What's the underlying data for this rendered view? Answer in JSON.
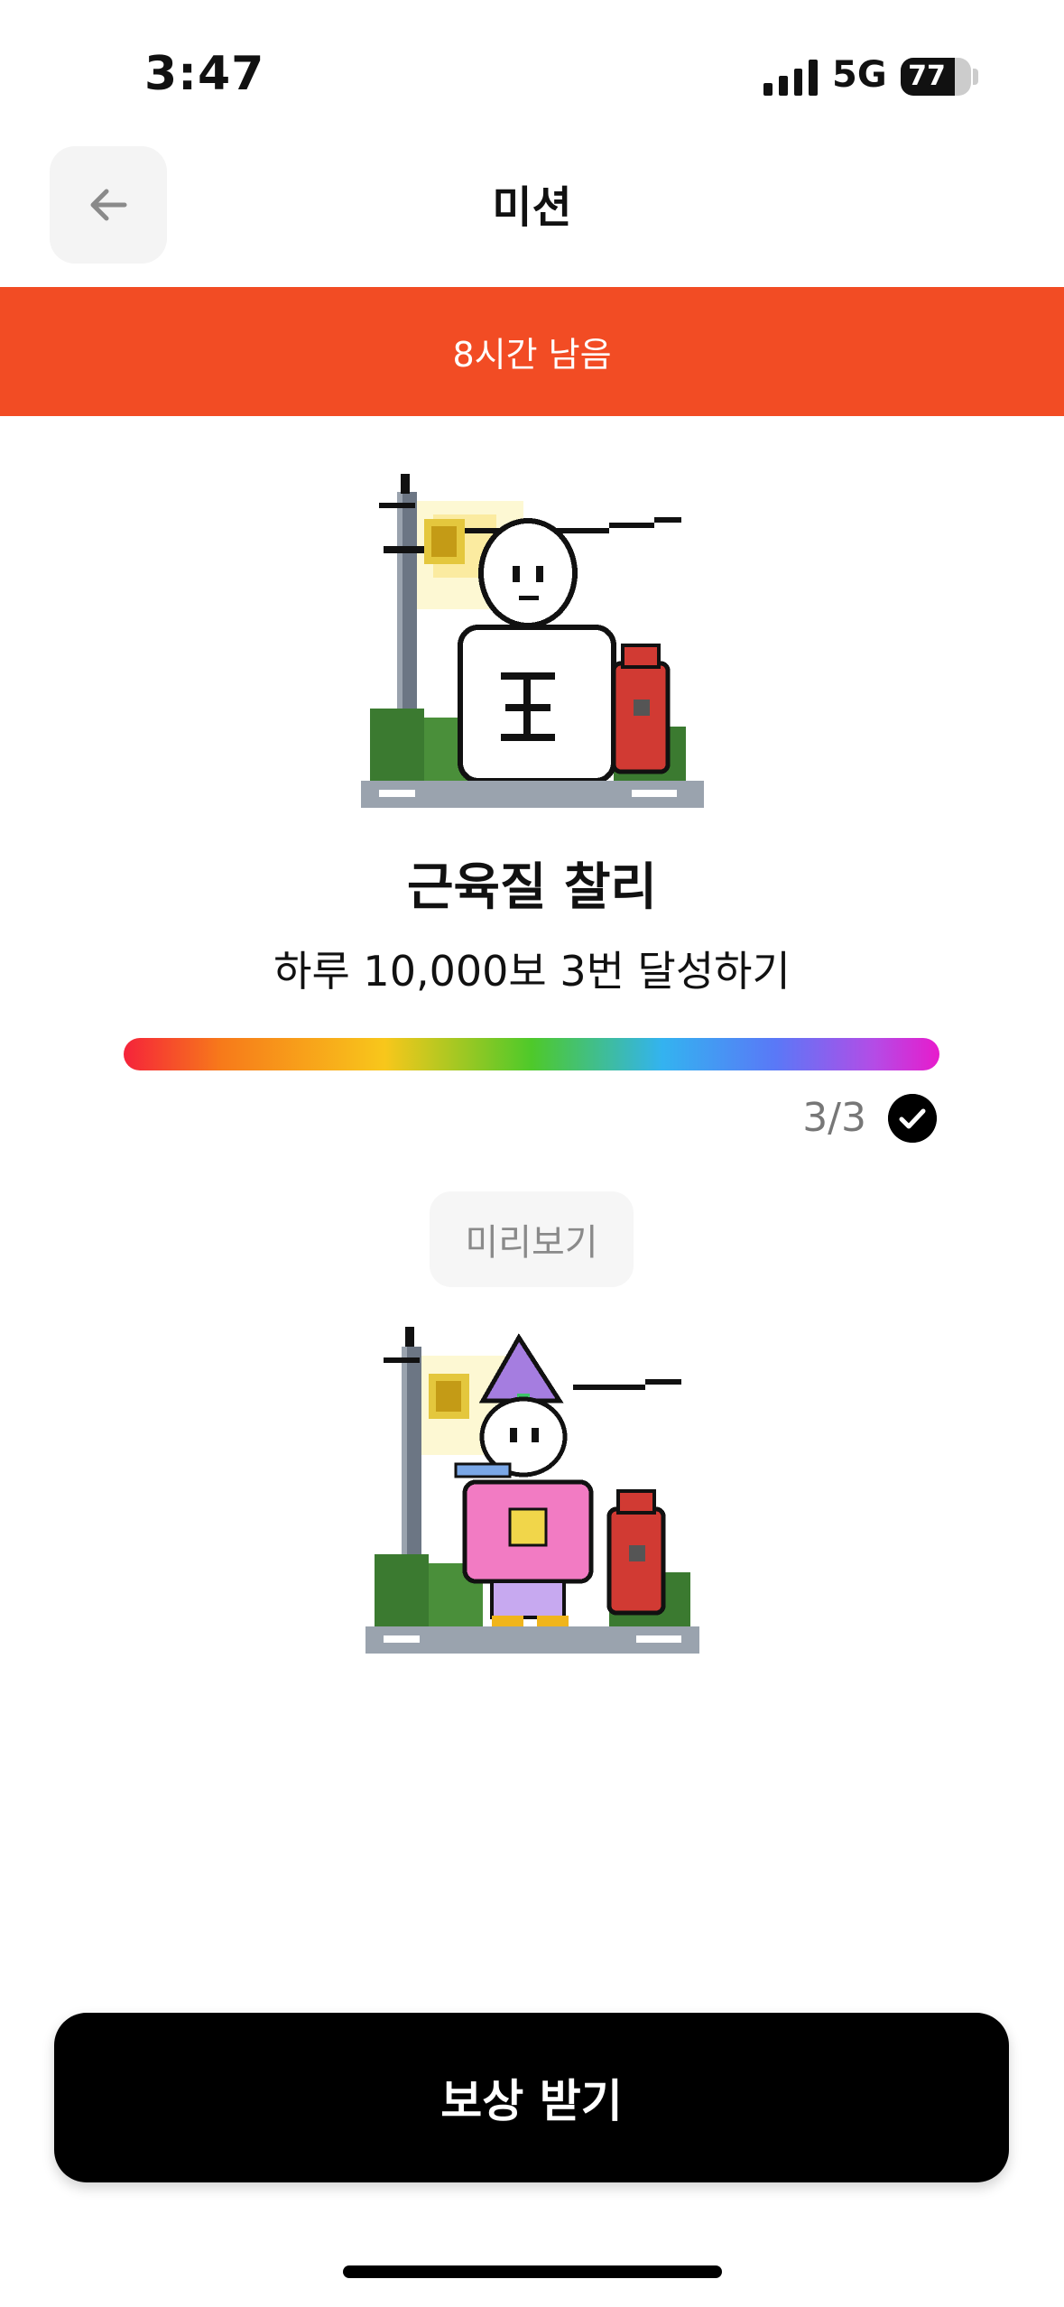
{
  "status": {
    "time": "3:47",
    "network": "5G",
    "battery": "77",
    "battery_level": 0.77
  },
  "nav": {
    "title": "미션",
    "back_icon": "arrow-left-icon"
  },
  "banner": {
    "text": "8시간 남음",
    "color": "#f24c24"
  },
  "mission": {
    "name": "근육질 찰리",
    "description": "하루 10,000보 3번 달성하기",
    "progress_current": 3,
    "progress_total": 3,
    "progress_label": "3/3",
    "completed_icon": "check-circle-icon"
  },
  "preview": {
    "label": "미리보기"
  },
  "cta": {
    "label": "보상 받기"
  }
}
